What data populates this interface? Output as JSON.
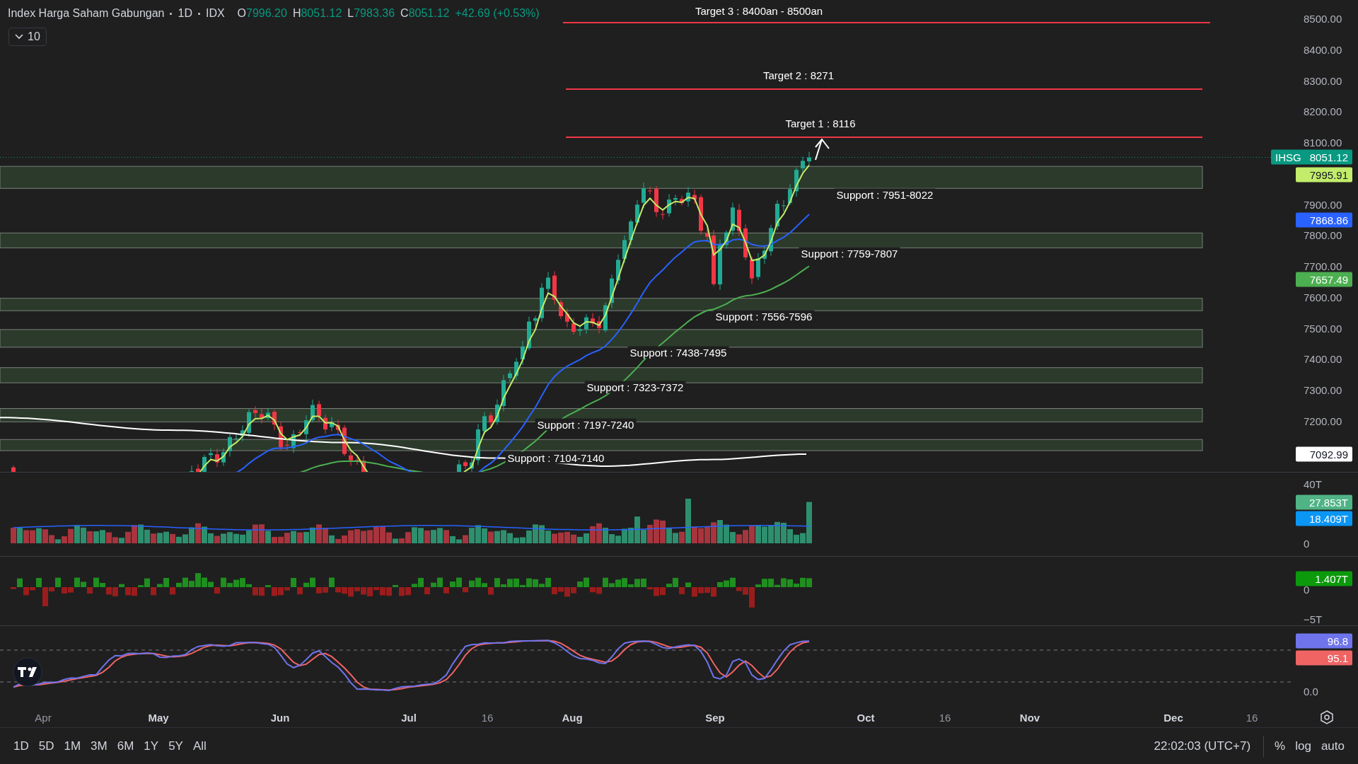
{
  "legend": {
    "title": "Index Harga Saham Gabungan",
    "interval": "1D",
    "exchange": "IDX",
    "ohlc": [
      {
        "key": "O",
        "value": "7996.20"
      },
      {
        "key": "H",
        "value": "8051.12"
      },
      {
        "key": "L",
        "value": "7983.36"
      },
      {
        "key": "C",
        "value": "8051.12"
      }
    ],
    "change": "+42.69 (+0.53%)"
  },
  "indicator_toggle": {
    "label": "10"
  },
  "targets": [
    {
      "label": "Target 3 : 8400an - 8500an"
    },
    {
      "label": "Target 2 : 8271"
    },
    {
      "label": "Target 1 : 8116"
    }
  ],
  "supports": [
    {
      "label": "Support : 7951-8022"
    },
    {
      "label": "Support : 7759-7807"
    },
    {
      "label": "Support : 7556-7596"
    },
    {
      "label": "Support : 7438-7495"
    },
    {
      "label": "Support : 7323-7372"
    },
    {
      "label": "Support : 7197-7240"
    },
    {
      "label": "Support : 7104-7140"
    }
  ],
  "price_axis": [
    "8500.00",
    "8400.00",
    "8300.00",
    "8200.00",
    "8100.00",
    "7900.00",
    "7800.00",
    "7700.00",
    "7600.00",
    "7500.00",
    "7400.00",
    "7300.00",
    "7200.00"
  ],
  "price_tags": [
    {
      "prefix": "IHSG",
      "label": "8051.12",
      "color": "#089981"
    },
    {
      "label": "7995.91",
      "color": "#c2ec6a"
    },
    {
      "label": "7868.86",
      "color": "#2962ff"
    },
    {
      "label": "7657.49",
      "color": "#4caf50"
    },
    {
      "label": "7092.99",
      "color": "#ffffff"
    }
  ],
  "volume_pane": {
    "ticks": [
      "40T",
      "0"
    ],
    "tags": [
      {
        "label": "27.853T",
        "color": "#4fb386"
      },
      {
        "label": "18.409T",
        "color": "#0a96f5"
      }
    ]
  },
  "delta_pane": {
    "ticks": [
      "0",
      "−5T"
    ],
    "tags": [
      {
        "label": "1.407T",
        "color": "#0c9a0c"
      }
    ]
  },
  "stoch_pane": {
    "ticks": [
      "0.0"
    ],
    "tags": [
      {
        "label": "96.8",
        "color": "#6f74ec"
      },
      {
        "label": "95.1",
        "color": "#f06464"
      }
    ]
  },
  "time_axis": [
    "Apr",
    "May",
    "Jun",
    "Jul",
    "16",
    "Aug",
    "Sep",
    "Oct",
    "16",
    "Nov",
    "Dec",
    "16"
  ],
  "ranges": [
    "1D",
    "5D",
    "1M",
    "3M",
    "6M",
    "1Y",
    "5Y",
    "All"
  ],
  "clock": "22:02:03 (UTC+7)",
  "scale_options": [
    "%",
    "log",
    "auto"
  ]
}
